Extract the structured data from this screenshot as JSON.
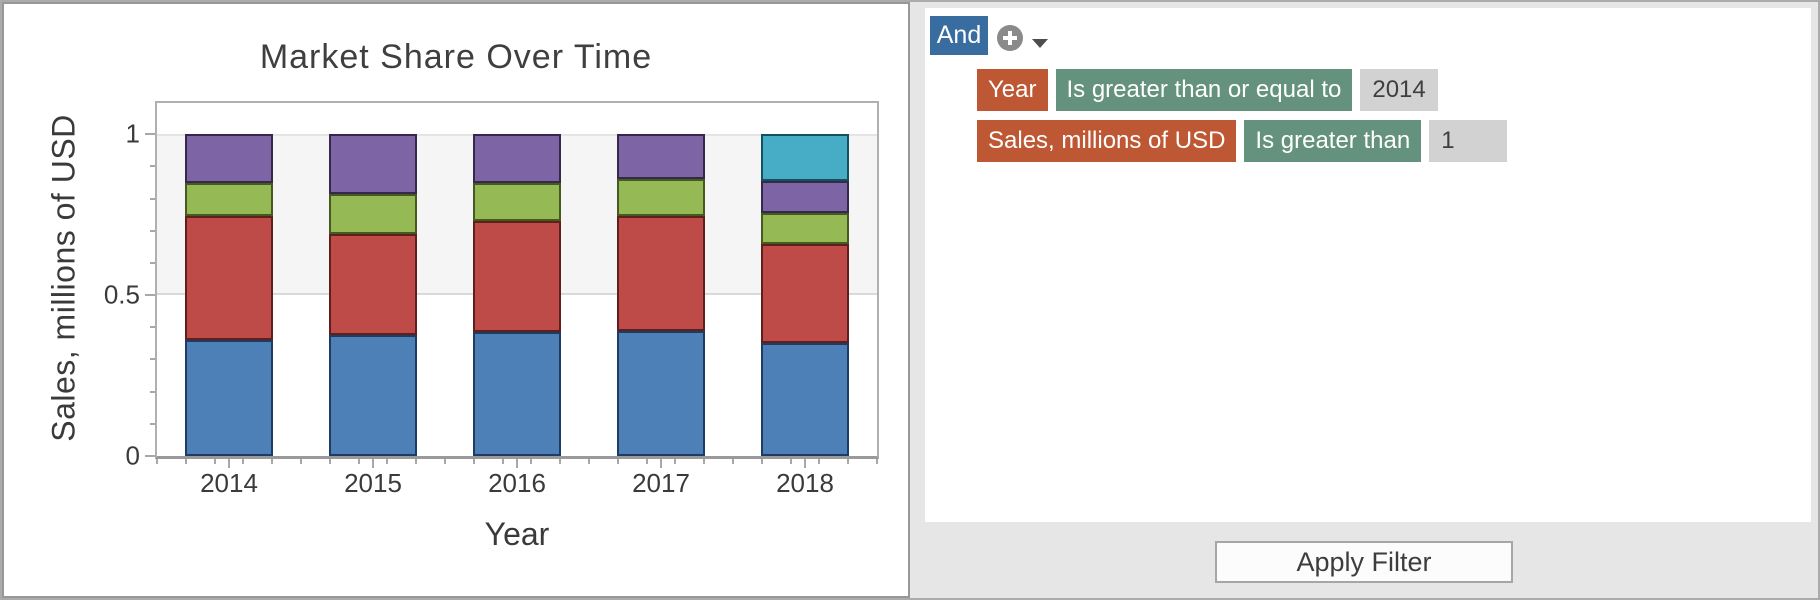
{
  "window": {
    "background": "#e6e6e6",
    "border_color": "#ababab",
    "panel_background": "#ffffff"
  },
  "chart_data": {
    "type": "bar",
    "stacked": true,
    "normalized": true,
    "title": "Market Share Over Time",
    "xlabel": "Year",
    "ylabel": "Sales, millions of USD",
    "categories": [
      "2014",
      "2015",
      "2016",
      "2017",
      "2018"
    ],
    "ylim": [
      0,
      1.1
    ],
    "yticks": [
      0,
      0.5,
      1
    ],
    "ytick_labels": [
      "0",
      "0.5",
      "1"
    ],
    "y_minor_tick_step": 0.1,
    "legend": "none",
    "grid": "shaded horizontal band between y=0.5 and y=1",
    "band": {
      "from": 0.5,
      "to": 1,
      "color": "#f5f5f5"
    },
    "series": [
      {
        "name": "blue-segment",
        "color": "#4e80b8",
        "border_color": "#1e3c61",
        "values": [
          0.36,
          0.375,
          0.385,
          0.39,
          0.35
        ]
      },
      {
        "name": "red-segment",
        "color": "#be4b48",
        "border_color": "#5f1f1d",
        "values": [
          0.385,
          0.315,
          0.345,
          0.355,
          0.31
        ]
      },
      {
        "name": "green-segment",
        "color": "#95b954",
        "border_color": "#46591f",
        "values": [
          0.105,
          0.125,
          0.12,
          0.115,
          0.095
        ]
      },
      {
        "name": "purple-segment",
        "color": "#7d64a5",
        "border_color": "#35284a",
        "values": [
          0.15,
          0.185,
          0.15,
          0.14,
          0.1
        ]
      },
      {
        "name": "cyan-segment",
        "color": "#47acc5",
        "border_color": "#14505e",
        "values": [
          0,
          0,
          0,
          0,
          0.145
        ]
      }
    ]
  },
  "filter": {
    "and_label": "And",
    "add_icon": "plus-circle-icon",
    "menu_icon": "chevron-down-icon",
    "conditions": [
      {
        "field": "Year",
        "operator": "Is greater than or equal to",
        "value": "2014"
      },
      {
        "field": "Sales, millions of USD",
        "operator": "Is greater than",
        "value": "1"
      }
    ],
    "apply_label": "Apply Filter",
    "colors": {
      "and_button": "#3a6d9f",
      "field_chip": "#be5733",
      "operator_chip": "#64927f",
      "value_chip": "#d2d2d2",
      "value_text": "#3f3f3f",
      "add_icon_circle": "#8a8a8a",
      "caret": "#4d4d4d"
    }
  }
}
